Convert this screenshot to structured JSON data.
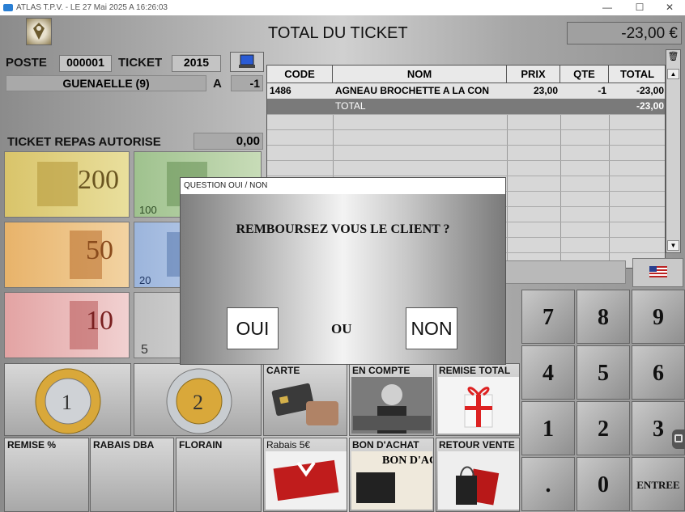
{
  "window": {
    "title": "ATLAS T.P.V. - LE 27 Mai 2025 A 16:26:03",
    "minimize": "—",
    "maximize": "☐",
    "close": "✕"
  },
  "header": {
    "title": "TOTAL DU TICKET",
    "total": "-23,00 €"
  },
  "info": {
    "poste_label": "POSTE",
    "poste_value": "000001",
    "ticket_label": "TICKET",
    "ticket_value": "2015",
    "operator": "GUENAELLE (9)",
    "a_label": "A",
    "a_value": "-1",
    "ticket_repas_label": "TICKET REPAS AUTORISE",
    "ticket_repas_value": "0,00"
  },
  "table": {
    "columns": [
      "CODE",
      "NOM",
      "PRIX",
      "QTE",
      "TOTAL"
    ],
    "rows": [
      {
        "code": "1486",
        "nom": "AGNEAU BROCHETTE A LA CON",
        "prix": "23,00",
        "qte": "-1",
        "total": "-23,00"
      }
    ],
    "total_row": {
      "label": "TOTAL",
      "value": "-23,00"
    }
  },
  "banknotes": [
    {
      "value": "200",
      "color": "#c9b24a"
    },
    {
      "value": "100",
      "color": "#6e9a5a"
    },
    {
      "value": "50",
      "color": "#d08a3a"
    },
    {
      "value": "20",
      "color": "#5f86c0"
    },
    {
      "value": "10",
      "color": "#c76a6a"
    },
    {
      "value": "5",
      "color": "#9a9a9a"
    }
  ],
  "coins": [
    "1",
    "2"
  ],
  "payment_buttons": {
    "carte": "CARTE",
    "en_compte": "EN COMPTE",
    "remise_total": "REMISE TOTAL",
    "remise_pct": "REMISE %",
    "rabais_dba": "RABAIS DBA",
    "florain": "FLORAIN",
    "rabais_5": "Rabais 5€",
    "bon_achat": "BON D'ACHAT",
    "retour_vente": "RETOUR VENTE",
    "bon_achat_img": "BON D'ACHA"
  },
  "keypad": {
    "k7": "7",
    "k8": "8",
    "k9": "9",
    "k4": "4",
    "k5": "5",
    "k6": "6",
    "k1": "1",
    "k2": "2",
    "k3": "3",
    "kdot": ".",
    "k0": "0",
    "entree": "ENTREE"
  },
  "dialog": {
    "title": "QUESTION OUI / NON",
    "question": "REMBOURSEZ VOUS LE CLIENT ?",
    "yes": "OUI",
    "or": "OU",
    "no": "NON"
  },
  "colors": {
    "accent_blue": "#2a5bd4",
    "table_total_row": "#7a7a7a"
  }
}
